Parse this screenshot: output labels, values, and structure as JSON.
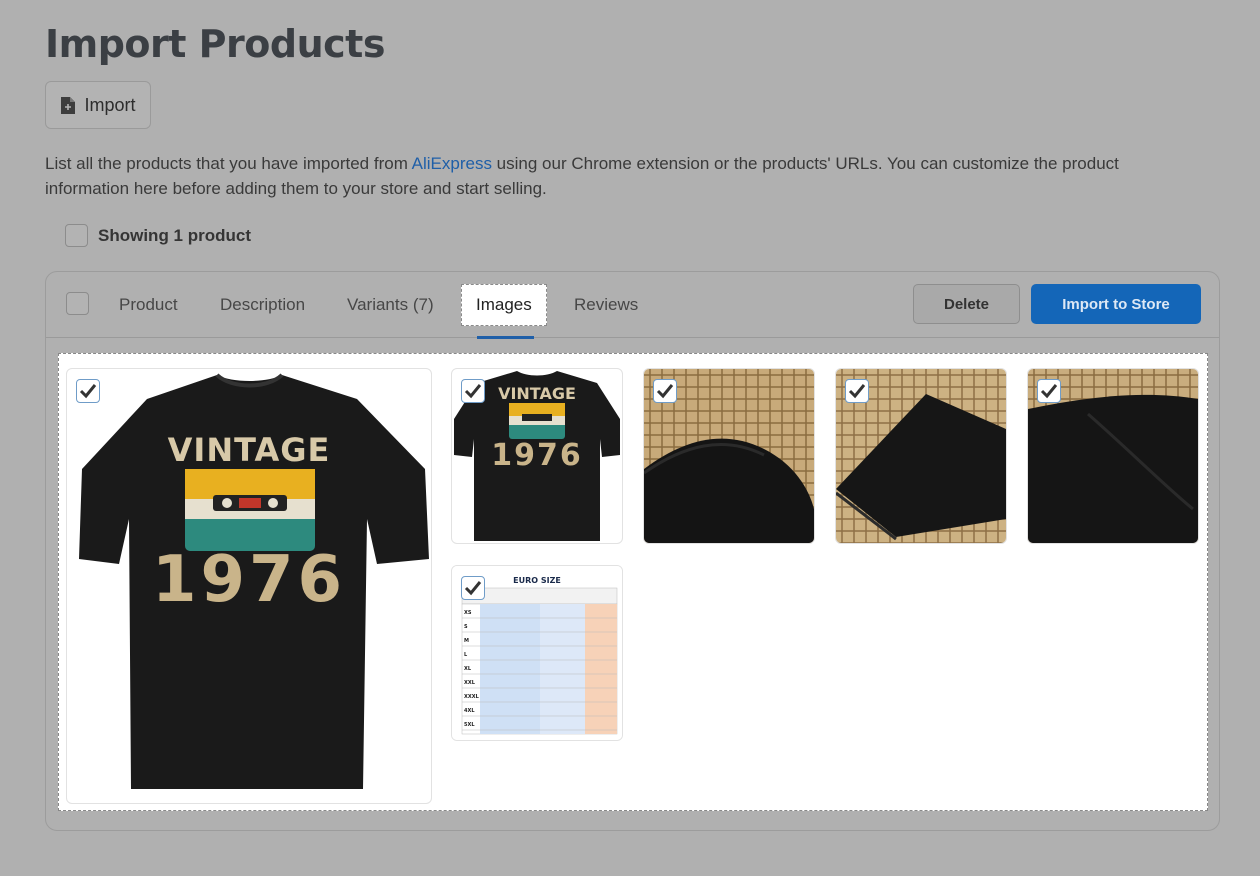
{
  "page": {
    "title": "Import Products",
    "import_button": "Import",
    "intro_before": "List all the products that you have imported from ",
    "intro_link": "AliExpress",
    "intro_after": " using our Chrome extension or the products' URLs. You can customize the product information here before adding them to your store and start selling.",
    "showing_label": "Showing 1 product"
  },
  "tabs": [
    {
      "label": "Product",
      "active": false
    },
    {
      "label": "Description",
      "active": false
    },
    {
      "label": "Variants (7)",
      "active": false
    },
    {
      "label": "Images",
      "active": true
    },
    {
      "label": "Reviews",
      "active": false
    }
  ],
  "actions": {
    "delete_label": "Delete",
    "import_to_store_label": "Import to Store"
  },
  "images": [
    {
      "name": "main-shirt-image",
      "selected": true
    },
    {
      "name": "shirt-thumbnail",
      "selected": true
    },
    {
      "name": "collar-detail",
      "selected": true
    },
    {
      "name": "hem-detail",
      "selected": true
    },
    {
      "name": "fabric-detail",
      "selected": true
    },
    {
      "name": "size-chart",
      "selected": true
    }
  ],
  "artwork": {
    "shirt_text_top": "VINTAGE",
    "shirt_text_year": "1976",
    "size_chart_title": "EURO SIZE",
    "size_chart_sizes": [
      "XS",
      "S",
      "M",
      "L",
      "XL",
      "XXL",
      "XXXL",
      "4XL",
      "5XL"
    ]
  },
  "colors": {
    "accent": "#1466b8",
    "link": "#1f5fa8",
    "overlay_bg": "#b0b0b0"
  }
}
